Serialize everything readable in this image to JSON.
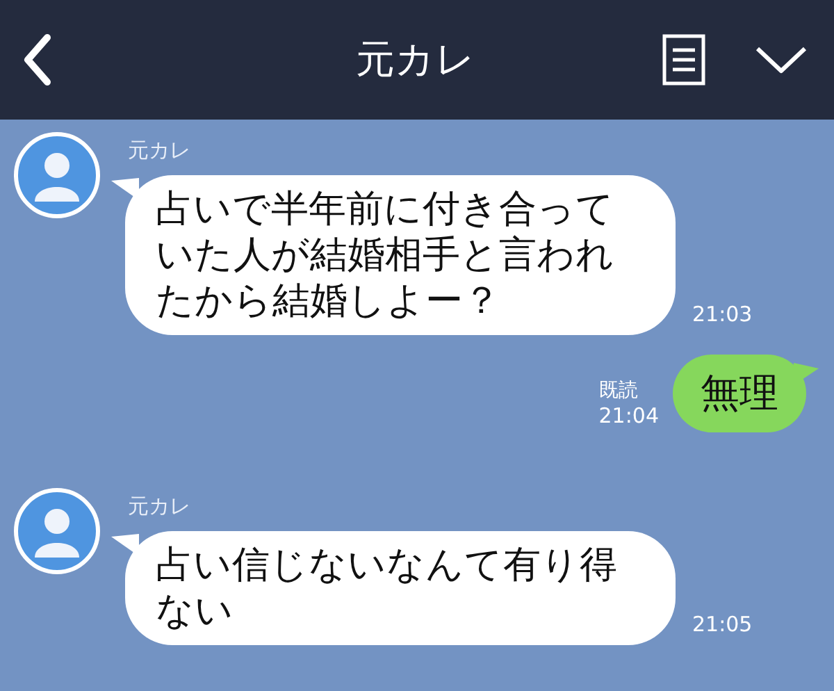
{
  "header": {
    "title": "元カレ"
  },
  "messages": [
    {
      "kind": "left",
      "sender": "元カレ",
      "text": "占いで半年前に付き合っていた人が結婚相手と言われたから結婚しよー？",
      "time": "21:03"
    },
    {
      "kind": "right",
      "read": "既読",
      "text": "無理",
      "time": "21:04"
    },
    {
      "kind": "left",
      "sender": "元カレ",
      "text": "占い信じないなんて有り得ない",
      "time": "21:05"
    }
  ]
}
